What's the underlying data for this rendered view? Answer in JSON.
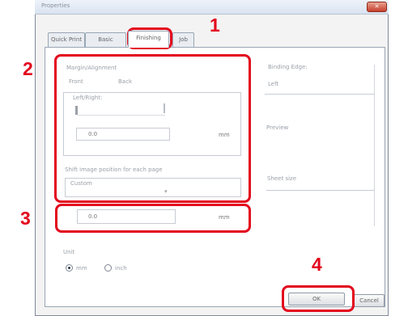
{
  "window": {
    "title": "Properties",
    "close_label": "✕"
  },
  "tabs": [
    {
      "label": "Quick Print",
      "active": false
    },
    {
      "label": "Basic",
      "active": false
    },
    {
      "label": "Finishing",
      "active": true
    },
    {
      "label": "Job",
      "active": false
    }
  ],
  "left_panel": {
    "group_title": "Margin/Alignment",
    "sub_labels": [
      "Front",
      "Back"
    ],
    "inner_title": "Left/Right:",
    "input_value": "0.0",
    "unit_label": "mm",
    "lower_title": "Shift image position for each page",
    "dropdown_value": "Custom"
  },
  "row3": {
    "input_value": "0.0",
    "unit_label": "mm"
  },
  "right_panel": {
    "label1": "Binding Edge:",
    "value1": "Left",
    "label2": "Preview",
    "label3": "Sheet size"
  },
  "bottom": {
    "label": "Unit",
    "radio_options": [
      {
        "label": "mm",
        "checked": true
      },
      {
        "label": "inch",
        "checked": false
      }
    ]
  },
  "buttons": {
    "ok": "OK",
    "cancel": "Cancel"
  },
  "callouts": [
    "1",
    "2",
    "3",
    "4"
  ],
  "colors": {
    "highlight": "#e3061d",
    "callout": "#e3061d"
  }
}
